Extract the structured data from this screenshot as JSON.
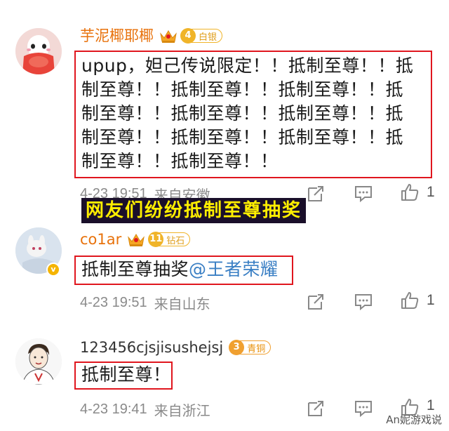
{
  "comments": [
    {
      "username": "芋泥椰耶椰",
      "level": "4",
      "level_label": "白银",
      "text_lines": [
        "upup，妲己传说限定！！抵制至尊！！抵",
        "制至尊！！抵制至尊！！抵制至尊！！抵",
        "制至尊！！抵制至尊！！抵制至尊！！抵",
        "制至尊！！抵制至尊！！抵制至尊！！抵",
        "制至尊！！抵制至尊！！"
      ],
      "time": "4-23 19:51",
      "location": "来自安徽",
      "likes": "1"
    },
    {
      "username": "co1ar",
      "level": "11",
      "level_label": "钻石",
      "text": "抵制至尊抽奖",
      "mention": "@王者荣耀",
      "time": "4-23 19:51",
      "location": "来自山东",
      "likes": "1",
      "verified": "v"
    },
    {
      "username": "123456cjsjisushejsj",
      "level": "3",
      "level_label": "青铜",
      "text": "抵制至尊！",
      "time": "4-23 19:41",
      "location": "来自浙江",
      "likes": "1"
    }
  ],
  "caption": "网友们纷纷抵制至尊抽奖",
  "watermark": "An妮游戏说",
  "colors": {
    "highlight_border": "#e0161e",
    "username_vip": "#e8720c",
    "mention": "#3a7fc4",
    "caption_text": "#ffee00",
    "caption_bg": "#1a0f2a"
  },
  "icons": [
    "crown-icon",
    "share-icon",
    "comment-icon",
    "like-icon",
    "verified-icon"
  ]
}
